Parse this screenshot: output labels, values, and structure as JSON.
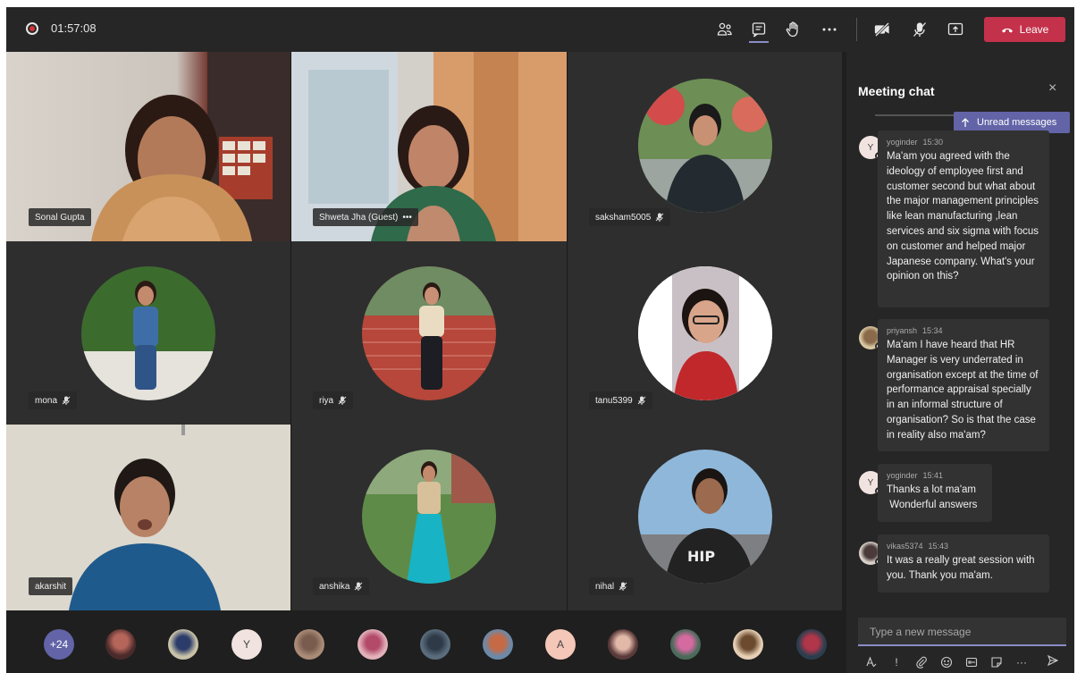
{
  "topbar": {
    "timer": "01:57:08",
    "leave_label": "Leave",
    "icons": [
      "participants-icon",
      "chat-icon",
      "raise-hand-icon",
      "more-icon",
      "camera-off-icon",
      "mic-off-icon",
      "share-screen-icon",
      "phone-hangup-icon"
    ]
  },
  "grid": {
    "tiles": [
      {
        "name": "Sonal Gupta"
      },
      {
        "name": "Shweta Jha (Guest)",
        "extra": "•••"
      },
      {
        "name": "saksham5005"
      },
      {
        "name": "mona"
      },
      {
        "name": "riya"
      },
      {
        "name": "tanu5399"
      },
      {
        "name": "akarshit"
      },
      {
        "name": "anshika"
      },
      {
        "name": "nihal"
      }
    ]
  },
  "participants_bar": {
    "overflow_count": "+24",
    "avatars": [
      {
        "initial": ""
      },
      {
        "initial": ""
      },
      {
        "initial": "Y"
      },
      {
        "initial": ""
      },
      {
        "initial": ""
      },
      {
        "initial": ""
      },
      {
        "initial": ""
      },
      {
        "initial": "A"
      },
      {
        "initial": ""
      },
      {
        "initial": ""
      },
      {
        "initial": ""
      },
      {
        "initial": ""
      }
    ]
  },
  "chat": {
    "title": "Meeting chat",
    "close_glyph": "×",
    "unread_label": "Unread messages",
    "messages": [
      {
        "author": "yoginder",
        "time": "15:30",
        "avatar": "Y",
        "text": "Ma'am you agreed with the ideology of employee first and customer second but what about the major management principles like lean manufacturing ,lean services and six sigma with focus on customer and helped major Japanese company. What's your opinion on this?"
      },
      {
        "author": "priyansh",
        "time": "15:34",
        "avatar": "",
        "text": "Ma'am I have heard that HR Manager is very underrated in organisation except at the time of performance appraisal specially in an informal structure of organisation? So is that the case in reality also ma'am?"
      },
      {
        "author": "yoginder",
        "time": "15:41",
        "avatar": "Y",
        "text_lines": [
          "Thanks a lot ma'am",
          " Wonderful answers"
        ]
      },
      {
        "author": "vikas5374",
        "time": "15:43",
        "avatar": "",
        "text": "It was a really great session with you. Thank you ma'am."
      }
    ],
    "compose_placeholder": "Type a new message",
    "compose_tools": [
      "format-icon",
      "priority-icon",
      "attach-icon",
      "emoji-icon",
      "gif-icon",
      "sticker-icon",
      "more-options-icon",
      "send-icon"
    ],
    "compose_glyphs": {
      "priority": "!",
      "more": "···"
    }
  }
}
